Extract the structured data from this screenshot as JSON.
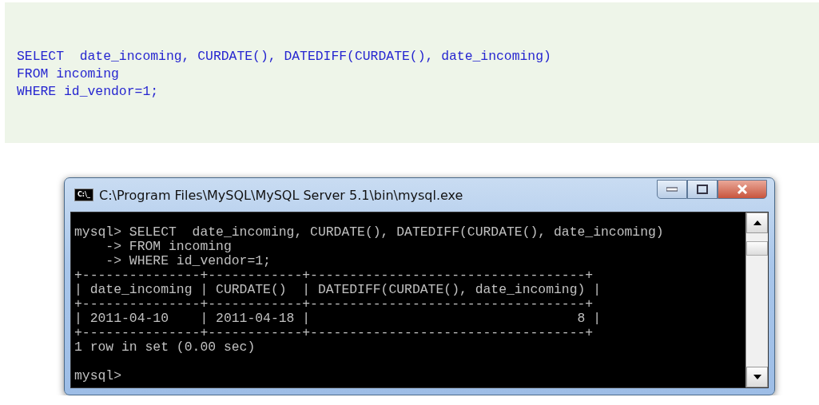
{
  "code_block": {
    "lines": [
      "SELECT  date_incoming, CURDATE(), DATEDIFF(CURDATE(), date_incoming)",
      "FROM incoming",
      "WHERE id_vendor=1;"
    ]
  },
  "window": {
    "title": "C:\\Program Files\\MySQL\\MySQL Server 5.1\\bin\\mysql.exe",
    "icon_text": "C:\\_",
    "console_lines": [
      "mysql> SELECT  date_incoming, CURDATE(), DATEDIFF(CURDATE(), date_incoming)",
      "    -> FROM incoming",
      "    -> WHERE id_vendor=1;",
      "+---------------+------------+-----------------------------------+",
      "| date_incoming | CURDATE()  | DATEDIFF(CURDATE(), date_incoming) |",
      "+---------------+------------+-----------------------------------+",
      "| 2011-04-10    | 2011-04-18 |                                  8 |",
      "+---------------+------------+-----------------------------------+",
      "1 row in set (0.00 sec)"
    ],
    "prompt": "mysql>"
  }
}
